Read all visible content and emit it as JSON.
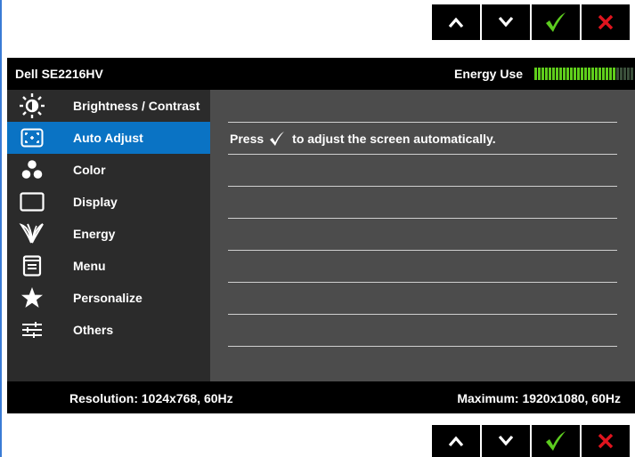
{
  "buttons": {
    "up": "up-arrow-icon",
    "down": "down-arrow-icon",
    "confirm": "checkmark-icon",
    "exit": "close-icon",
    "confirm_color": "#5ccc1f",
    "exit_color": "#e0141e"
  },
  "header": {
    "model": "Dell SE2216HV",
    "energy_label": "Energy Use",
    "energy_level": 0.82,
    "energy_color_on": "#5fce1b",
    "energy_color_off": "#3a4f3a"
  },
  "sidebar": {
    "items": [
      {
        "label": "Brightness / Contrast",
        "icon": "brightness-icon"
      },
      {
        "label": "Auto Adjust",
        "icon": "auto-adjust-icon"
      },
      {
        "label": "Color",
        "icon": "color-icon"
      },
      {
        "label": "Display",
        "icon": "display-icon"
      },
      {
        "label": "Energy",
        "icon": "energy-icon"
      },
      {
        "label": "Menu",
        "icon": "menu-icon"
      },
      {
        "label": "Personalize",
        "icon": "star-icon"
      },
      {
        "label": "Others",
        "icon": "sliders-icon"
      }
    ],
    "active_index": 1,
    "active_color": "#0a73c4"
  },
  "content": {
    "press_text": "Press",
    "instruction": "to adjust the screen automatically."
  },
  "footer": {
    "resolution": "Resolution: 1024x768, 60Hz",
    "maximum": "Maximum: 1920x1080, 60Hz"
  }
}
